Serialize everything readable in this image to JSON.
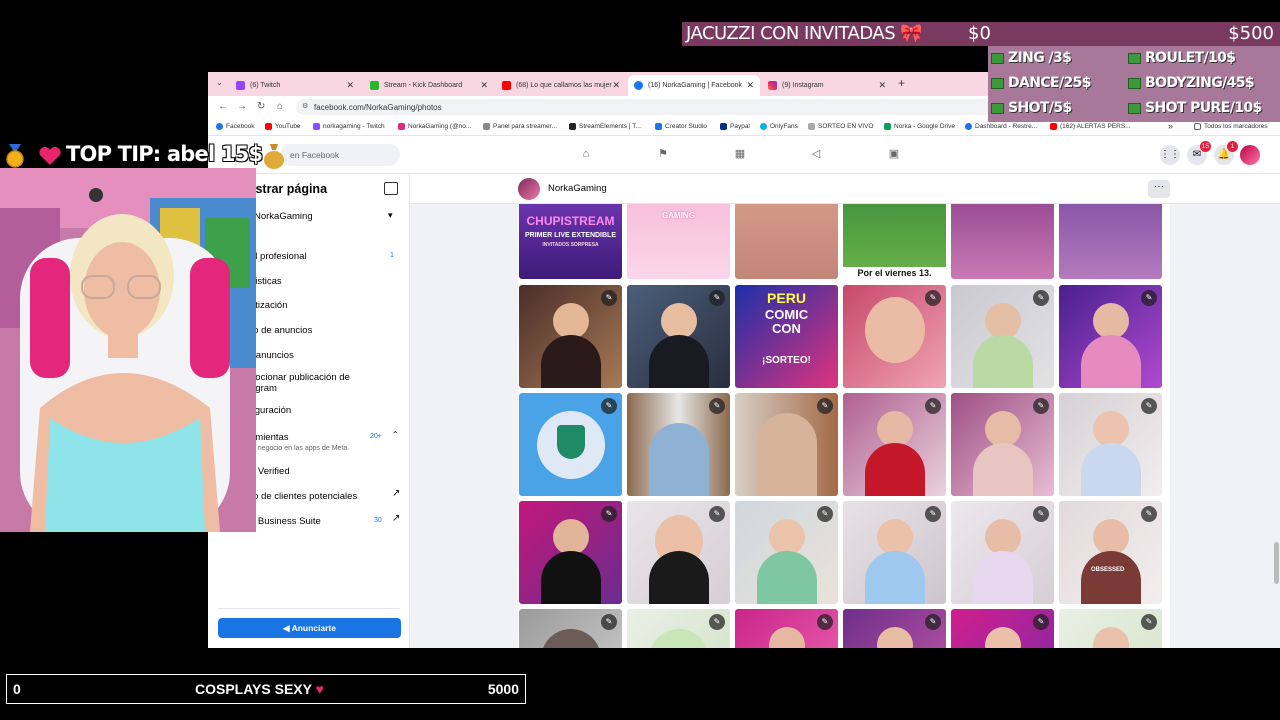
{
  "browser": {
    "tabs": [
      {
        "label": "(6) Twitch",
        "active": false
      },
      {
        "label": "Stream - Kick Dashboard",
        "active": false
      },
      {
        "label": "(68) Lo que callamos las mujer",
        "active": false
      },
      {
        "label": "(16) NorkaGaming | Facebook",
        "active": true
      },
      {
        "label": "(9) Instagram",
        "active": false
      }
    ],
    "new_tab": "+",
    "url": "facebook.com/NorkaGaming/photos",
    "bookmarks": [
      "Facebook",
      "YouTube",
      "norkagaming - Twitch",
      "NorkaGaming (@no...",
      "Panel para streamer...",
      "StreamElements | T...",
      "Creator Studio",
      "Paypal",
      "OnlyFans",
      "SORTEO EN VIVO",
      "Norka - Google Drive",
      "Dashboard - Restre...",
      "(162) ALERTAS PERS..."
    ],
    "bookmarks_more": "»",
    "all_bookmarks": "Todos los marcadores"
  },
  "facebook": {
    "search_placeholder": "en Facebook",
    "messenger_badge": "15",
    "notif_badge": "1",
    "left_menu": {
      "title": "istrar página",
      "page_name": "NorkaGaming",
      "items": [
        {
          "label": "el profesional",
          "count": "1"
        },
        {
          "label": "disticas",
          "count": ""
        },
        {
          "label": "etización",
          "count": ""
        },
        {
          "label": "ro de anuncios",
          "count": ""
        },
        {
          "label": "r anuncios",
          "count": ""
        },
        {
          "label": "nocionar publicación de",
          "count": ""
        },
        {
          "label": "agram",
          "count": ""
        },
        {
          "label": "figuración",
          "count": ""
        },
        {
          "label": "amientas",
          "count": "20+"
        },
        {
          "label": "tu negocio en las apps de Meta.",
          "count": ""
        },
        {
          "label": "a Verified",
          "count": ""
        },
        {
          "label": "ro de clientes potenciales",
          "count": ""
        },
        {
          "label": "a Business Suite",
          "count": "30"
        }
      ],
      "advertise_button": "Anunciarte"
    },
    "page_header_name": "NorkaGaming",
    "more_button": "···",
    "photo_captions": {
      "chupistream_title": "CHUPISTREAM",
      "chupistream_sub": "PRIMER LIVE EXTENDIBLE",
      "chupistream_small": "INVITADOS SORPRESA",
      "gaming_tag": "GAMING",
      "viernes": "Por el viernes 13.",
      "peru_line1": "PERU",
      "peru_line2": "COMIC",
      "peru_line3": "CON",
      "peru_sorteo": "¡SORTEO!",
      "obsessed": "OBSESSED"
    }
  },
  "overlays": {
    "goal_top": {
      "label": "JACUZZI CON INVITADAS",
      "current": "$0",
      "target": "$500"
    },
    "tip_menu": [
      {
        "label": "ZING /3$"
      },
      {
        "label": "ROULET/10$"
      },
      {
        "label": "DANCE/25$"
      },
      {
        "label": "BODYZING/45$"
      },
      {
        "label": "SHOT/5$"
      },
      {
        "label": "SHOT PURE/10$"
      }
    ],
    "top_tip": "TOP TIP: abel 15$",
    "goal_bottom": {
      "current": "0",
      "label": "COSPLAYS SEXY",
      "target": "5000"
    }
  },
  "colors": {
    "fb_blue": "#1b74e4",
    "tab_strip": "#f8d7e3",
    "goal_bar": "#7a3a60",
    "menu_bg": "#a7789a"
  }
}
